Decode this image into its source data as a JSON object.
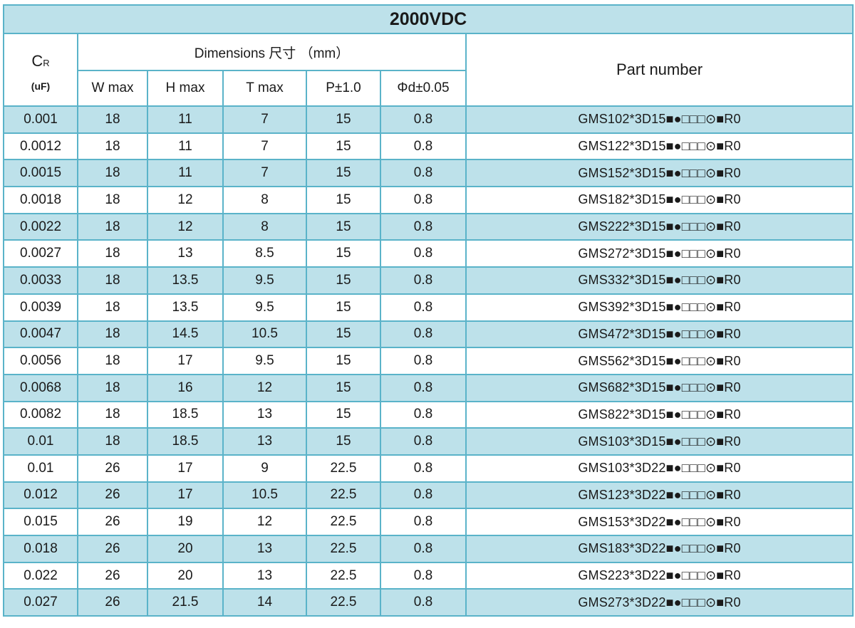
{
  "title": "2000VDC",
  "headers": {
    "cr_main": "C",
    "cr_sub": "R",
    "cr_unit": "(uF)",
    "dimensions": "Dimensions 尺寸 （mm）",
    "w": "W max",
    "h": "H max",
    "t": "T max",
    "p": "P±1.0",
    "d": "Φd±0.05",
    "part": "Part number"
  },
  "rows": [
    {
      "cr": "0.001",
      "w": "18",
      "h": "11",
      "t": "7",
      "p": "15",
      "d": "0.8",
      "part": "GMS102*3D15■●□□□⊙■R0"
    },
    {
      "cr": "0.0012",
      "w": "18",
      "h": "11",
      "t": "7",
      "p": "15",
      "d": "0.8",
      "part": "GMS122*3D15■●□□□⊙■R0"
    },
    {
      "cr": "0.0015",
      "w": "18",
      "h": "11",
      "t": "7",
      "p": "15",
      "d": "0.8",
      "part": "GMS152*3D15■●□□□⊙■R0"
    },
    {
      "cr": "0.0018",
      "w": "18",
      "h": "12",
      "t": "8",
      "p": "15",
      "d": "0.8",
      "part": "GMS182*3D15■●□□□⊙■R0"
    },
    {
      "cr": "0.0022",
      "w": "18",
      "h": "12",
      "t": "8",
      "p": "15",
      "d": "0.8",
      "part": "GMS222*3D15■●□□□⊙■R0"
    },
    {
      "cr": "0.0027",
      "w": "18",
      "h": "13",
      "t": "8.5",
      "p": "15",
      "d": "0.8",
      "part": "GMS272*3D15■●□□□⊙■R0"
    },
    {
      "cr": "0.0033",
      "w": "18",
      "h": "13.5",
      "t": "9.5",
      "p": "15",
      "d": "0.8",
      "part": "GMS332*3D15■●□□□⊙■R0"
    },
    {
      "cr": "0.0039",
      "w": "18",
      "h": "13.5",
      "t": "9.5",
      "p": "15",
      "d": "0.8",
      "part": "GMS392*3D15■●□□□⊙■R0"
    },
    {
      "cr": "0.0047",
      "w": "18",
      "h": "14.5",
      "t": "10.5",
      "p": "15",
      "d": "0.8",
      "part": "GMS472*3D15■●□□□⊙■R0"
    },
    {
      "cr": "0.0056",
      "w": "18",
      "h": "17",
      "t": "9.5",
      "p": "15",
      "d": "0.8",
      "part": "GMS562*3D15■●□□□⊙■R0"
    },
    {
      "cr": "0.0068",
      "w": "18",
      "h": "16",
      "t": "12",
      "p": "15",
      "d": "0.8",
      "part": "GMS682*3D15■●□□□⊙■R0"
    },
    {
      "cr": "0.0082",
      "w": "18",
      "h": "18.5",
      "t": "13",
      "p": "15",
      "d": "0.8",
      "part": "GMS822*3D15■●□□□⊙■R0"
    },
    {
      "cr": "0.01",
      "w": "18",
      "h": "18.5",
      "t": "13",
      "p": "15",
      "d": "0.8",
      "part": "GMS103*3D15■●□□□⊙■R0"
    },
    {
      "cr": "0.01",
      "w": "26",
      "h": "17",
      "t": "9",
      "p": "22.5",
      "d": "0.8",
      "part": "GMS103*3D22■●□□□⊙■R0"
    },
    {
      "cr": "0.012",
      "w": "26",
      "h": "17",
      "t": "10.5",
      "p": "22.5",
      "d": "0.8",
      "part": "GMS123*3D22■●□□□⊙■R0"
    },
    {
      "cr": "0.015",
      "w": "26",
      "h": "19",
      "t": "12",
      "p": "22.5",
      "d": "0.8",
      "part": "GMS153*3D22■●□□□⊙■R0"
    },
    {
      "cr": "0.018",
      "w": "26",
      "h": "20",
      "t": "13",
      "p": "22.5",
      "d": "0.8",
      "part": "GMS183*3D22■●□□□⊙■R0"
    },
    {
      "cr": "0.022",
      "w": "26",
      "h": "20",
      "t": "13",
      "p": "22.5",
      "d": "0.8",
      "part": "GMS223*3D22■●□□□⊙■R0"
    },
    {
      "cr": "0.027",
      "w": "26",
      "h": "21.5",
      "t": "14",
      "p": "22.5",
      "d": "0.8",
      "part": "GMS273*3D22■●□□□⊙■R0"
    }
  ],
  "colors": {
    "band": "#bde1ea",
    "border": "#5ab3c9"
  }
}
